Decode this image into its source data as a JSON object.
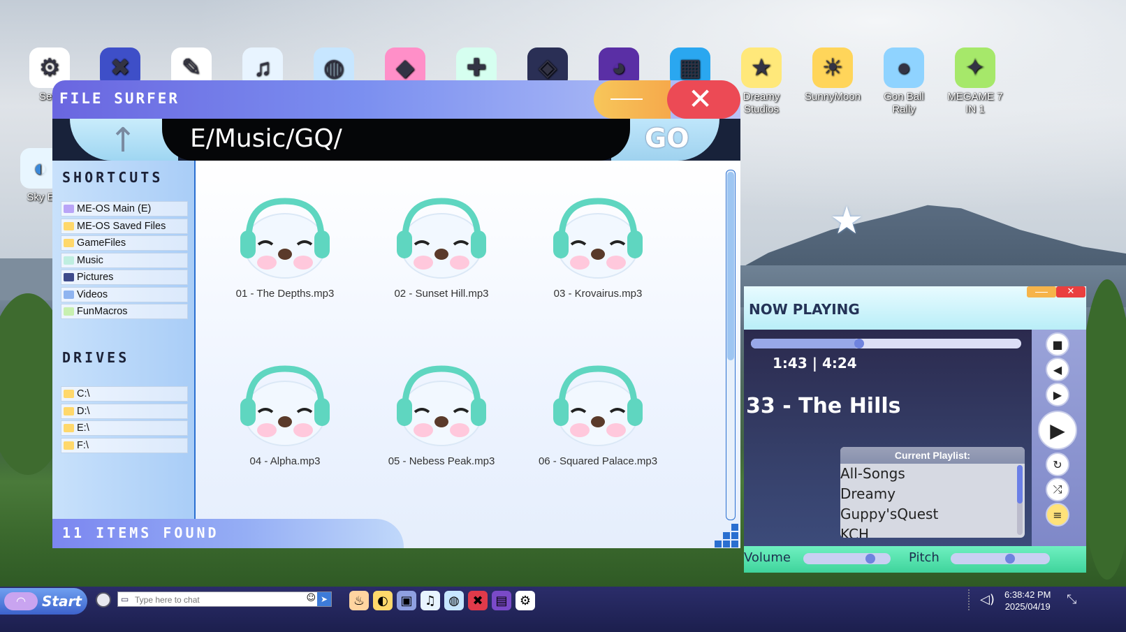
{
  "desktop": {
    "icons_top": [
      {
        "name": "settings-app-icon",
        "label": "Setti",
        "glyph": "⚙",
        "bg": "#ffffff"
      },
      {
        "name": "media-app-icon",
        "label": "",
        "glyph": "✖",
        "bg": "#3e4fc8"
      },
      {
        "name": "paint-app-icon",
        "label": "",
        "glyph": "✎",
        "bg": "#ffffff"
      },
      {
        "name": "music-app-icon",
        "label": "",
        "glyph": "♫",
        "bg": "#e8f4ff"
      },
      {
        "name": "globe-app-icon",
        "label": "",
        "glyph": "◍",
        "bg": "#c7e6ff"
      },
      {
        "name": "shop-app-icon",
        "label": "",
        "glyph": "◆",
        "bg": "#ff8fc8"
      },
      {
        "name": "puzzle-app-icon",
        "label": "",
        "glyph": "✚",
        "bg": "#d6fff0"
      },
      {
        "name": "gamepad-app-icon",
        "label": "",
        "glyph": "◈",
        "bg": "#2a2f55"
      },
      {
        "name": "cat-app-icon",
        "label": "",
        "glyph": "◕",
        "bg": "#5a2fa5"
      },
      {
        "name": "pixel-face-app-icon",
        "label": "",
        "glyph": "▦",
        "bg": "#2aa7f0"
      },
      {
        "name": "dreamy-studios-icon",
        "label": "Dreamy Studios",
        "glyph": "★",
        "bg": "#ffe87a"
      },
      {
        "name": "sunnymoon-icon",
        "label": "SunnyMoon",
        "glyph": "☀",
        "bg": "#ffd55a"
      },
      {
        "name": "gon-ball-rally-icon",
        "label": "Gon Ball Rally",
        "glyph": "●",
        "bg": "#8fd3ff"
      },
      {
        "name": "megame-icon",
        "label": "MEGAME 7 IN 1",
        "glyph": "✦",
        "bg": "#a6e86a"
      }
    ],
    "icon_left2": {
      "label": "Sky E",
      "glyph": "◐",
      "bg": "#e8f6ff"
    }
  },
  "file_surfer": {
    "title": "FILE SURFER",
    "minimize": "—",
    "close": "✕",
    "up_arrow": "↑",
    "path": "E/Music/GQ/",
    "go_label": "GO",
    "shortcuts_heading": "SHORTCUTS",
    "shortcuts": [
      {
        "label": "ME-OS Main (E)",
        "color": "#b9a4f7"
      },
      {
        "label": "ME-OS Saved Files",
        "color": "#ffd86b"
      },
      {
        "label": "GameFiles",
        "color": "#ffd86b"
      },
      {
        "label": "Music",
        "color": "#bfeee0"
      },
      {
        "label": "Pictures",
        "color": "#3e4a8a"
      },
      {
        "label": "Videos",
        "color": "#8fb4f0"
      },
      {
        "label": "FunMacros",
        "color": "#c8f0b0"
      }
    ],
    "drives_heading": "DRIVES",
    "drives": [
      {
        "label": "C:\\",
        "color": "#ffd86b"
      },
      {
        "label": "D:\\",
        "color": "#ffd86b"
      },
      {
        "label": "E:\\",
        "color": "#ffd86b"
      },
      {
        "label": "F:\\",
        "color": "#ffd86b"
      }
    ],
    "files": [
      "01 - The Depths.mp3",
      "02 - Sunset Hill.mp3",
      "03 - Krovairus.mp3",
      "04 - Alpha.mp3",
      "05 - Nebess Peak.mp3",
      "06 - Squared Palace.mp3"
    ],
    "status": "11 ITEMS FOUND"
  },
  "now_playing": {
    "title": "NOW PLAYING",
    "minimize": "—",
    "close": "✕",
    "time": "1:43 | 4:24",
    "progress": 0.4,
    "song": "33 - The Hills",
    "playlist_header": "Current Playlist:",
    "playlists": [
      "All-Songs",
      "Dreamy",
      "Guppy'sQuest",
      "KCH"
    ],
    "controls": {
      "stop": "■",
      "prev": "◀",
      "next": "▶",
      "play": "▶",
      "repeat": "↻",
      "shuffle": "⤮",
      "list": "≡"
    },
    "volume_label": "Volume",
    "volume": 0.77,
    "pitch_label": "Pitch",
    "pitch": 0.6
  },
  "taskbar": {
    "start_label": "Start",
    "chat_placeholder": "Type here to chat",
    "time": "6:38:42 PM",
    "date": "2025/04/19",
    "apps": [
      {
        "name": "taskbar-fire-icon",
        "glyph": "♨",
        "bg": "#ffd4a0"
      },
      {
        "name": "taskbar-folder-icon",
        "glyph": "◐",
        "bg": "#ffd86b"
      },
      {
        "name": "taskbar-pictures-icon",
        "glyph": "▣",
        "bg": "#8fa0e0"
      },
      {
        "name": "taskbar-music-icon",
        "glyph": "♫",
        "bg": "#e8f4ff"
      },
      {
        "name": "taskbar-globe-icon",
        "glyph": "◍",
        "bg": "#c7e6ff"
      },
      {
        "name": "taskbar-x-icon",
        "glyph": "✖",
        "bg": "#e03a4a"
      },
      {
        "name": "taskbar-media-icon",
        "glyph": "▤",
        "bg": "#7a4ac8"
      },
      {
        "name": "taskbar-settings-icon",
        "glyph": "⚙",
        "bg": "#ffffff"
      }
    ]
  }
}
